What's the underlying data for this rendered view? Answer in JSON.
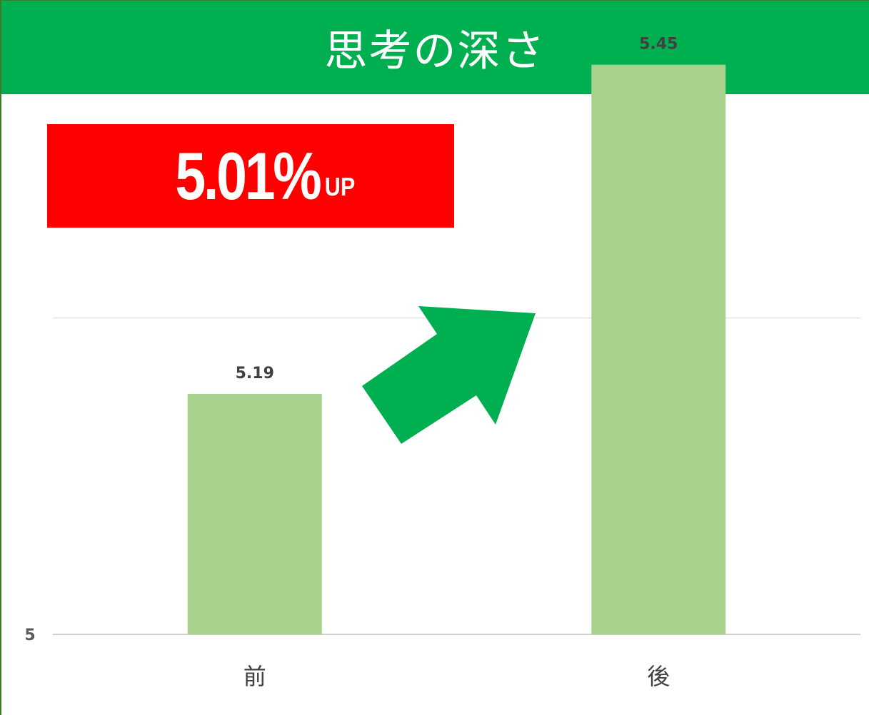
{
  "header": {
    "title": "思考の深さ",
    "bg_color": "#00AF4F"
  },
  "badge": {
    "value": "5.01%",
    "suffix": "UP",
    "bg_color": "#FF0000"
  },
  "arrow": {
    "icon": "up-right-arrow-icon",
    "color": "#00AF4F"
  },
  "chart_data": {
    "type": "bar",
    "categories": [
      "前",
      "後"
    ],
    "values": [
      5.19,
      5.45
    ],
    "data_labels": [
      "5.19",
      "5.45"
    ],
    "y_axis_min_label": "5",
    "ylim": [
      5,
      5.5
    ],
    "grid": true,
    "bar_color": "#A9D18E",
    "title": "",
    "xlabel": "",
    "ylabel": ""
  }
}
